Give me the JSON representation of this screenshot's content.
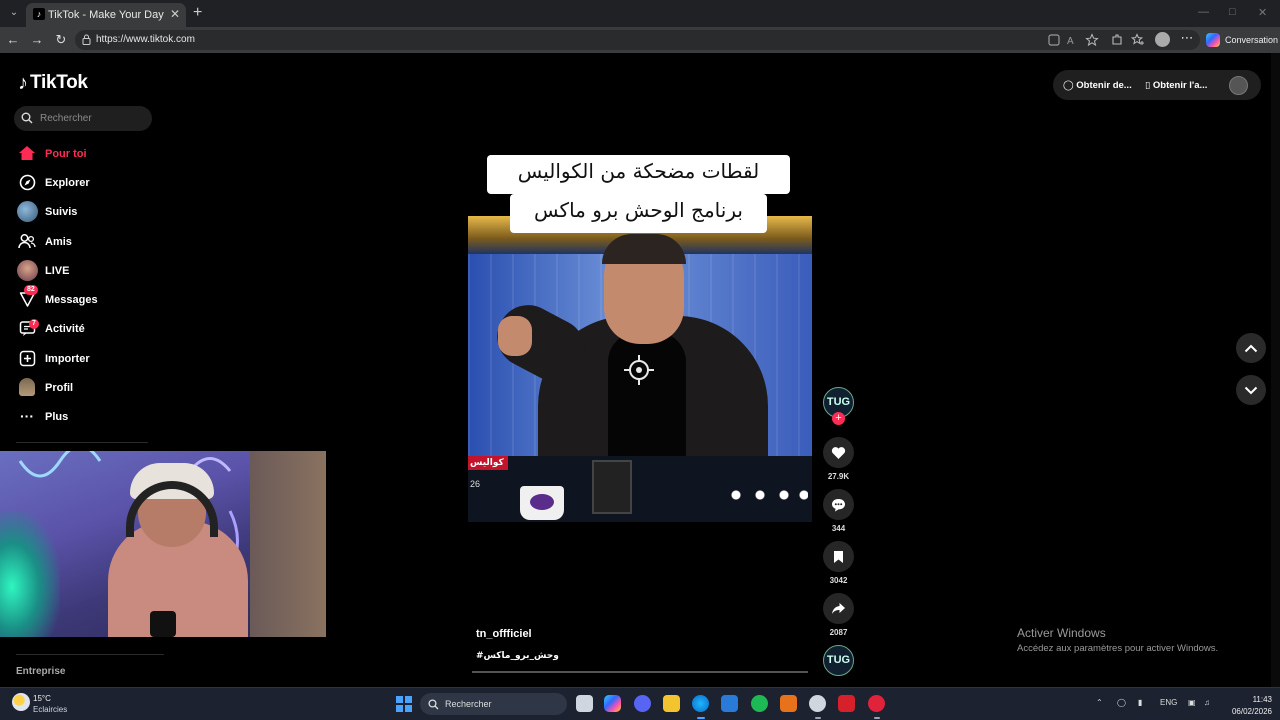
{
  "browser": {
    "tab_title": "TikTok - Make Your Day",
    "url": "https://www.tiktok.com",
    "conversation_label": "Conversation"
  },
  "tiktok": {
    "logo_text": "TikTok",
    "search_placeholder": "Rechercher",
    "nav": [
      {
        "label": "Pour toi",
        "icon": "home-icon",
        "active": true
      },
      {
        "label": "Explorer",
        "icon": "compass-icon"
      },
      {
        "label": "Suivis",
        "icon": "following-avatar-icon"
      },
      {
        "label": "Amis",
        "icon": "friends-icon"
      },
      {
        "label": "LIVE",
        "icon": "live-avatar-icon"
      },
      {
        "label": "Messages",
        "icon": "send-icon",
        "badge": "82"
      },
      {
        "label": "Activité",
        "icon": "activity-icon",
        "badge": "7"
      },
      {
        "label": "Importer",
        "icon": "upload-icon"
      },
      {
        "label": "Profil",
        "icon": "profile-avatar-icon"
      },
      {
        "label": "Plus",
        "icon": "more-icon"
      }
    ],
    "footer_label": "Entreprise",
    "header_buttons": {
      "coins": "Obtenir de...",
      "app": "Obtenir l'a..."
    },
    "video": {
      "caption_line1": "لقطات مضحكة من الكواليس",
      "caption_line2": "برنامج الوحش برو ماكس",
      "banner_text": "كواليس",
      "corner_number": "26",
      "creator_avatar_text": "TUG",
      "username": "tn_offficiel",
      "hashtag": "#وحش_برو_ماكس"
    },
    "actions": {
      "likes": "27.9K",
      "comments": "344",
      "saves": "3042",
      "shares": "2087"
    }
  },
  "windows_activation": {
    "title": "Activer Windows",
    "subtitle": "Accédez aux paramètres pour activer Windows."
  },
  "taskbar": {
    "temperature": "15°C",
    "weather": "Eclaircies",
    "search_label": "Rechercher",
    "language": "ENG",
    "time": "11:43",
    "date": "06/02/2026"
  }
}
